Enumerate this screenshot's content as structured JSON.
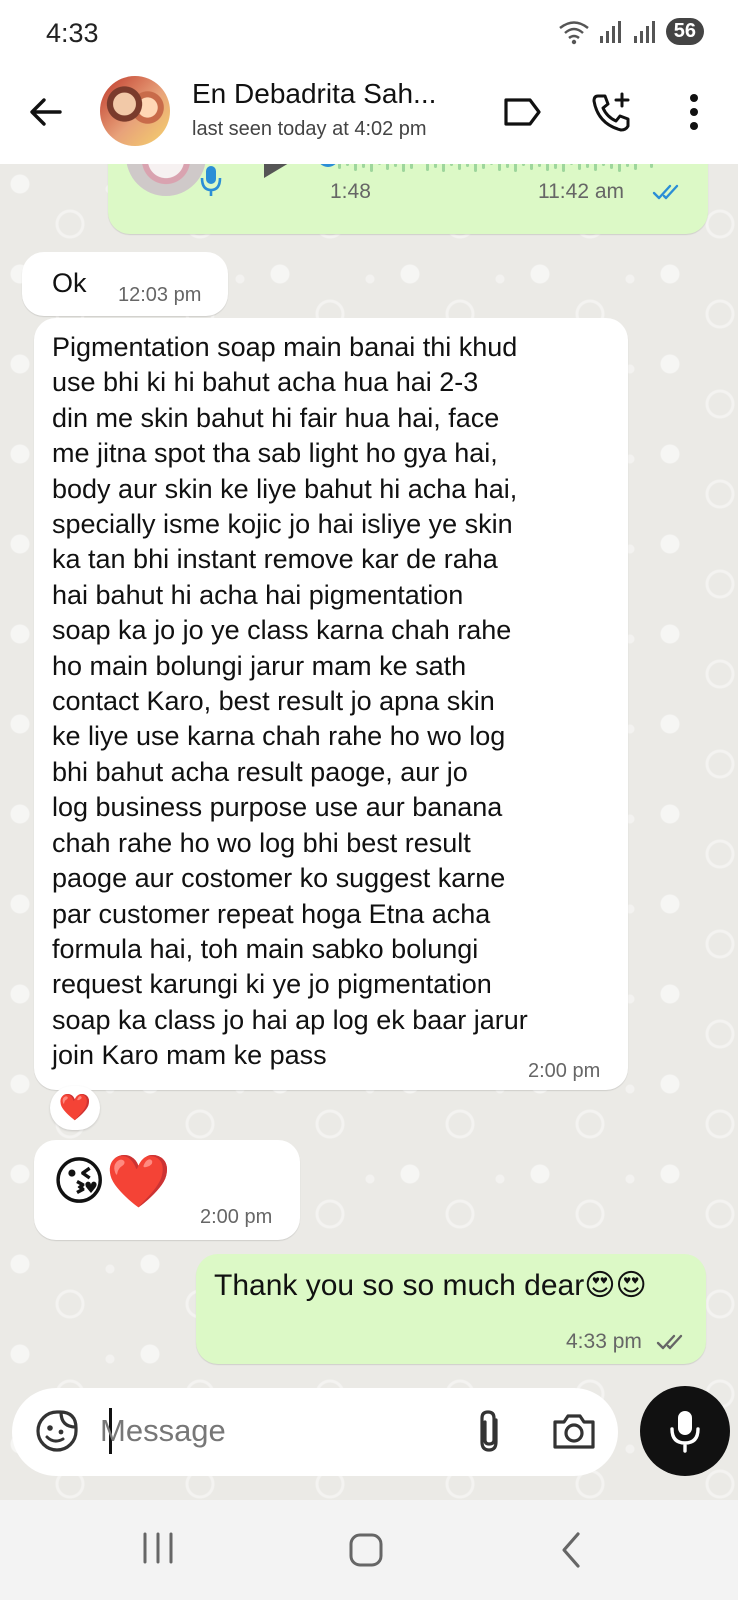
{
  "status_bar": {
    "time": "4:33",
    "battery": "56"
  },
  "header": {
    "contact_name": "En Debadrita Sah...",
    "last_seen": "last seen today at 4:02 pm"
  },
  "messages": [
    {
      "type": "voice",
      "direction": "out",
      "duration": "1:48",
      "time": "11:42 am",
      "read": true
    },
    {
      "type": "text",
      "direction": "in",
      "text": "Ok",
      "time": "12:03 pm"
    },
    {
      "type": "text",
      "direction": "in",
      "time": "2:00 pm",
      "reaction": "❤️",
      "lines": [
        "Pigmentation soap main banai thi khud",
        "use bhi ki hi bahut acha hua hai 2-3",
        "din me skin bahut hi fair hua hai, face",
        "me jitna spot tha sab light ho gya hai,",
        "body aur skin ke liye bahut hi acha hai,",
        "specially isme kojic jo hai isliye ye skin",
        "ka tan bhi instant remove kar de raha",
        "hai bahut hi acha hai pigmentation",
        "soap ka jo jo ye class karna chah rahe",
        "ho main bolungi jarur mam ke sath",
        "contact Karo, best result jo apna skin",
        "ke liye use karna chah rahe ho wo log",
        "bhi bahut acha result paoge, aur jo",
        "log business purpose use aur banana",
        "chah rahe ho wo log bhi best result",
        "paoge aur costomer ko suggest karne",
        "par customer repeat hoga Etna acha",
        "formula hai, toh main sabko bolungi",
        "request karungi ki ye jo pigmentation",
        "soap ka class jo hai ap log ek baar jarur",
        "join Karo mam ke pass"
      ]
    },
    {
      "type": "emoji",
      "direction": "in",
      "text": "😘❤️",
      "time": "2:00 pm"
    },
    {
      "type": "text",
      "direction": "out",
      "text": "Thank you so so much dear😍😍",
      "time": "4:33 pm",
      "read": false
    }
  ],
  "composer": {
    "placeholder": "Message"
  },
  "icons": {
    "back": "arrow-left-icon",
    "label": "label-icon",
    "call": "add-call-icon",
    "menu": "more-vert-icon",
    "emoji": "sticker-icon",
    "attach": "paperclip-icon",
    "camera": "camera-icon",
    "mic": "microphone-icon"
  },
  "colors": {
    "incoming": "#ffffff",
    "outgoing": "#dcf9c6",
    "read_tick": "#2b8ed6",
    "wallpaper": "#ebeae6"
  }
}
